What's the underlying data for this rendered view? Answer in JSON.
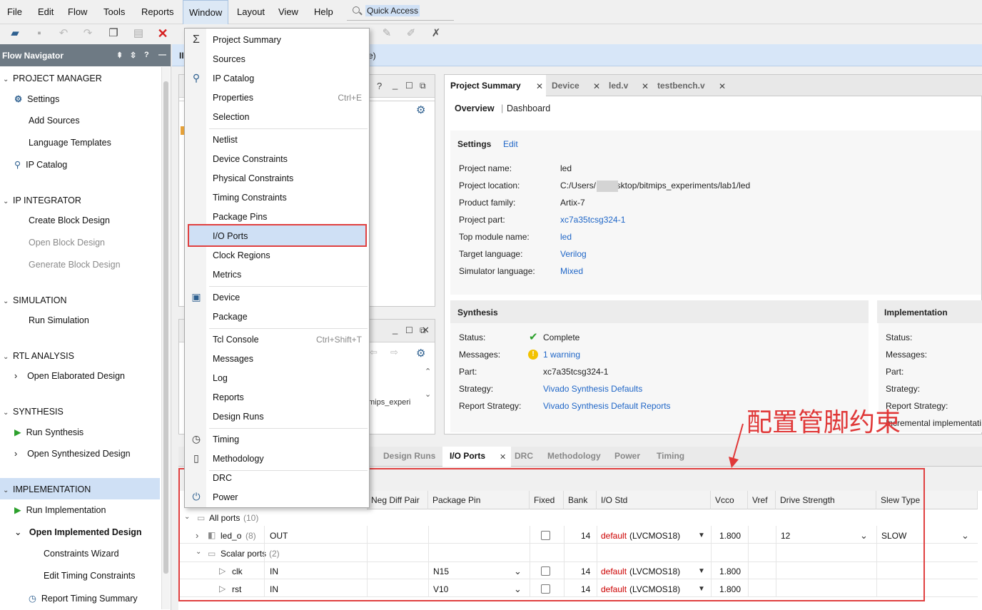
{
  "menubar": {
    "items": [
      "File",
      "Edit",
      "Flow",
      "Tools",
      "Reports",
      "Window",
      "Layout",
      "View",
      "Help"
    ],
    "active": "Window",
    "quick_access": "Quick Access"
  },
  "flow_navigator": {
    "title": "Flow Navigator",
    "project_manager": "PROJECT MANAGER",
    "pm_items": [
      "Settings",
      "Add Sources",
      "Language Templates",
      "IP Catalog"
    ],
    "ip_integrator": "IP INTEGRATOR",
    "ipi_items": [
      "Create Block Design",
      "Open Block Design",
      "Generate Block Design"
    ],
    "simulation": "SIMULATION",
    "sim_items": [
      "Run Simulation"
    ],
    "rtl": "RTL ANALYSIS",
    "rtl_items": [
      "Open Elaborated Design"
    ],
    "synthesis": "SYNTHESIS",
    "syn_items": [
      "Run Synthesis",
      "Open Synthesized Design"
    ],
    "implementation": "IMPLEMENTATION",
    "impl_items": [
      "Run Implementation",
      "Open Implemented Design",
      "Constraints Wizard",
      "Edit Timing Constraints",
      "Report Timing Summary"
    ]
  },
  "banner": {
    "prefix": "II",
    "suffix": "e)"
  },
  "window_menu": {
    "items": [
      {
        "label": "Project Summary",
        "shortcut": ""
      },
      {
        "label": "Sources",
        "shortcut": ""
      },
      {
        "label": "IP Catalog",
        "shortcut": ""
      },
      {
        "label": "Properties",
        "shortcut": "Ctrl+E"
      },
      {
        "label": "Selection",
        "shortcut": ""
      },
      {
        "label": "Netlist",
        "shortcut": ""
      },
      {
        "label": "Device Constraints",
        "shortcut": ""
      },
      {
        "label": "Physical Constraints",
        "shortcut": ""
      },
      {
        "label": "Timing Constraints",
        "shortcut": ""
      },
      {
        "label": "Package Pins",
        "shortcut": ""
      },
      {
        "label": "I/O Ports",
        "shortcut": ""
      },
      {
        "label": "Clock Regions",
        "shortcut": ""
      },
      {
        "label": "Metrics",
        "shortcut": ""
      },
      {
        "label": "Device",
        "shortcut": ""
      },
      {
        "label": "Package",
        "shortcut": ""
      },
      {
        "label": "Tcl Console",
        "shortcut": "Ctrl+Shift+T"
      },
      {
        "label": "Messages",
        "shortcut": ""
      },
      {
        "label": "Log",
        "shortcut": ""
      },
      {
        "label": "Reports",
        "shortcut": ""
      },
      {
        "label": "Design Runs",
        "shortcut": ""
      },
      {
        "label": "Timing",
        "shortcut": ""
      },
      {
        "label": "Methodology",
        "shortcut": ""
      },
      {
        "label": "DRC",
        "shortcut": ""
      },
      {
        "label": "Power",
        "shortcut": ""
      }
    ],
    "selected": "I/O Ports"
  },
  "summary": {
    "tabs": [
      "Project Summary",
      "Device",
      "led.v",
      "testbench.v"
    ],
    "overview": "Overview",
    "dashboard": "Dashboard",
    "settings_title": "Settings",
    "edit": "Edit",
    "settings": [
      {
        "label": "Project name:",
        "value": "led",
        "link": false
      },
      {
        "label": "Project location:",
        "value": "C:/Users/      1/Desktop/bitmips_experiments/lab1/led",
        "link": false
      },
      {
        "label": "Product family:",
        "value": "Artix-7",
        "link": false
      },
      {
        "label": "Project part:",
        "value": "xc7a35tcsg324-1",
        "link": true
      },
      {
        "label": "Top module name:",
        "value": "led",
        "link": true
      },
      {
        "label": "Target language:",
        "value": "Verilog",
        "link": true
      },
      {
        "label": "Simulator language:",
        "value": "Mixed",
        "link": true
      }
    ],
    "synthesis_title": "Synthesis",
    "synthesis": [
      {
        "label": "Status:",
        "value": "Complete"
      },
      {
        "label": "Messages:",
        "value": "1 warning"
      },
      {
        "label": "Part:",
        "value": "xc7a35tcsg324-1"
      },
      {
        "label": "Strategy:",
        "value": "Vivado Synthesis Defaults"
      },
      {
        "label": "Report Strategy:",
        "value": "Vivado Synthesis Default Reports"
      }
    ],
    "implementation_title": "Implementation",
    "implementation": [
      "Status:",
      "Messages:",
      "Part:",
      "Strategy:",
      "Report Strategy:"
    ],
    "impl_report_value": "Incremental implementati"
  },
  "small_panel": {
    "path_fragment": "mips_experi"
  },
  "bottom_tabs": [
    "Design Runs",
    "I/O Ports",
    "DRC",
    "Methodology",
    "Power",
    "Timing"
  ],
  "io_table": {
    "headers": [
      "Neg Diff Pair",
      "Package Pin",
      "Fixed",
      "Bank",
      "I/O Std",
      "Vcco",
      "Vref",
      "Drive Strength",
      "Slew Type"
    ],
    "all_ports": "All ports",
    "all_count": "(10)",
    "scalar": "Scalar ports",
    "scalar_count": "(2)",
    "rows": [
      {
        "name": "led_o",
        "count": "(8)",
        "dir": "OUT",
        "pin": "",
        "bank": "14",
        "std_prefix": "default",
        "std": "(LVCMOS18)",
        "vcco": "1.800",
        "drive": "12",
        "slew": "SLOW"
      },
      {
        "name": "clk",
        "count": "",
        "dir": "IN",
        "pin": "N15",
        "bank": "14",
        "std_prefix": "default",
        "std": "(LVCMOS18)",
        "vcco": "1.800",
        "drive": "",
        "slew": ""
      },
      {
        "name": "rst",
        "count": "",
        "dir": "IN",
        "pin": "V10",
        "bank": "14",
        "std_prefix": "default",
        "std": "(LVCMOS18)",
        "vcco": "1.800",
        "drive": "",
        "slew": ""
      }
    ]
  },
  "annotation": "配置管脚约束",
  "colors": {
    "highlight": "#e04040",
    "link": "#1f66c7",
    "selection": "#cfe0f5",
    "header": "#6e7a84"
  }
}
